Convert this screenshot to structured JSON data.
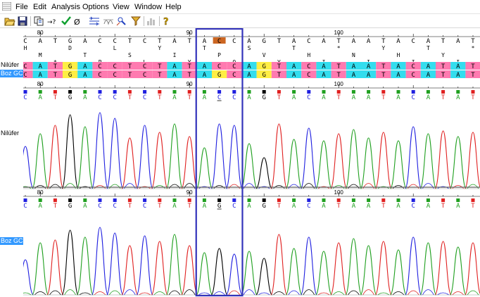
{
  "menu": [
    "File",
    "Edit",
    "Analysis",
    "Options",
    "View",
    "Window",
    "Help"
  ],
  "toolbar": [
    "open-icon",
    "save-icon",
    "copy-icon",
    "find-ambiguity-icon",
    "check-icon",
    "reverse-complement-icon",
    "edit-trace-icon",
    "mixed-base-icon",
    "search-icon",
    "chart-icon",
    "help-icon"
  ],
  "tracks": {
    "nilufer": "Nilüfer",
    "boz_gc": "Boz GC",
    "selected_track": "Boz GC"
  },
  "ruler_top": [
    {
      "pos": 80,
      "label": "80"
    },
    {
      "pos": 90,
      "label": "90"
    },
    {
      "pos": 100,
      "label": "100"
    }
  ],
  "consensus_seq": [
    "C",
    "A",
    "T",
    "G",
    "A",
    "C",
    "C",
    "T",
    "C",
    "T",
    "A",
    "T",
    "A",
    "C",
    "C",
    "A",
    "G",
    "T",
    "A",
    "C",
    "A",
    "T",
    "A",
    "A",
    "T",
    "A",
    "C",
    "A",
    "T",
    "A",
    "T"
  ],
  "highlighted_base_index": 13,
  "translation_frame1": [
    "H",
    "",
    "",
    "D",
    "",
    "",
    "L",
    "",
    "",
    "Y",
    "",
    "",
    "T",
    "",
    "",
    "S",
    "",
    "",
    "T",
    "",
    "",
    "*",
    "",
    "",
    "Y",
    "",
    "",
    "T",
    "",
    "",
    "*"
  ],
  "translation_frame2": [
    "",
    "M",
    "",
    "",
    "T",
    "",
    "",
    "S",
    "",
    "",
    "I",
    "",
    "",
    "P",
    "",
    "",
    "V",
    "",
    "",
    "H",
    "",
    "",
    "N",
    "",
    "",
    "H",
    "",
    "",
    "Y",
    ""
  ],
  "translation_frame3": [
    "",
    "",
    "*",
    "",
    "",
    "P",
    "",
    "",
    "L",
    "",
    "",
    "Y",
    "",
    "",
    "Q",
    "",
    "",
    "Y",
    "",
    "",
    "I",
    "",
    "",
    "I",
    "",
    "",
    "I",
    "",
    "",
    "I"
  ],
  "nilufer_seq": [
    "C",
    "A",
    "T",
    "G",
    "A",
    "C",
    "C",
    "T",
    "C",
    "T",
    "A",
    "T",
    "A",
    "C",
    "C",
    "A",
    "G",
    "T",
    "A",
    "C",
    "A",
    "T",
    "A",
    "A",
    "T",
    "A",
    "C",
    "A",
    "T",
    "A",
    "T"
  ],
  "bozgc_seq": [
    "C",
    "A",
    "T",
    "G",
    "A",
    "C",
    "C",
    "T",
    "C",
    "T",
    "A",
    "T",
    "A",
    "G",
    "C",
    "A",
    "G",
    "T",
    "A",
    "C",
    "A",
    "T",
    "A",
    "A",
    "T",
    "A",
    "C",
    "A",
    "T",
    "A",
    "T"
  ],
  "nilufer_calls": [
    "C",
    "A",
    "T",
    "G",
    "A",
    "C",
    "C",
    "T",
    "C",
    "T",
    "A",
    "T",
    "A",
    "C",
    "C",
    "A",
    "G",
    "T",
    "A",
    "C",
    "A",
    "T",
    "A",
    "A",
    "T",
    "A",
    "C",
    "A",
    "T",
    "A",
    "T"
  ],
  "bozgc_calls": [
    "C",
    "A",
    "T",
    "G",
    "A",
    "C",
    "C",
    "T",
    "C",
    "T",
    "A",
    "T",
    "A",
    "G",
    "C",
    "A",
    "G",
    "T",
    "A",
    "C",
    "A",
    "T",
    "A",
    "A",
    "T",
    "A",
    "C",
    "A",
    "T",
    "A",
    "T"
  ],
  "underlined_call_index": 13,
  "ruler_track1": [
    {
      "pos": 80,
      "label": "80"
    },
    {
      "pos": 90,
      "label": "90"
    },
    {
      "pos": 100,
      "label": "100"
    }
  ],
  "ruler_track2": [
    {
      "pos": 80,
      "label": "80"
    },
    {
      "pos": 90,
      "label": "90"
    },
    {
      "pos": 100,
      "label": "100"
    }
  ],
  "colors": {
    "A": "#20a020",
    "C": "#2020e0",
    "G": "#000000",
    "T": "#e02020",
    "bg_A": "#33ddee",
    "bg_C": "#ff7ab0",
    "bg_G": "#ffee44",
    "bg_T": "#ff7ab0",
    "highlight_box": "#3333bb",
    "highlight_base": "#cc6622"
  }
}
